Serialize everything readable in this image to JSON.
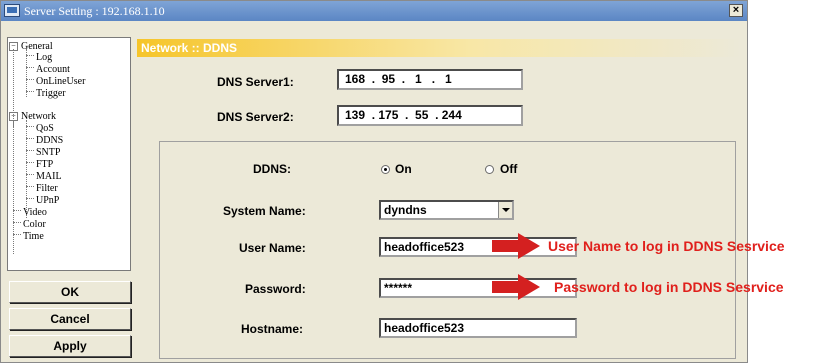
{
  "window": {
    "title": "Server Setting : 192.168.1.10",
    "close_label": "×"
  },
  "tree": {
    "general": {
      "label": "General",
      "toggle": "−",
      "children": [
        "Log",
        "Account",
        "OnLineUser",
        "Trigger"
      ]
    },
    "network": {
      "label": "Network",
      "toggle": "−",
      "children": [
        "QoS",
        "DDNS",
        "SNTP",
        "FTP",
        "MAIL",
        "Filter",
        "UPnP"
      ]
    },
    "others": [
      "Video",
      "Color",
      "Time"
    ]
  },
  "buttons": {
    "ok": "OK",
    "cancel": "Cancel",
    "apply": "Apply"
  },
  "panel": {
    "header": "Network :: DDNS",
    "dns1": {
      "label": "DNS Server1:",
      "value": "168  .  95  .   1   .   1"
    },
    "dns2": {
      "label": "DNS Server2:",
      "value": "139  . 175  .  55  . 244"
    },
    "ddns": {
      "label": "DDNS:",
      "on": "On",
      "off": "Off",
      "selected": "On"
    },
    "system_name": {
      "label": "System Name:",
      "value": "dyndns"
    },
    "user_name": {
      "label": "User Name:",
      "value": "headoffice523"
    },
    "password": {
      "label": "Password:",
      "value": "******"
    },
    "hostname": {
      "label": "Hostname:",
      "value": "headoffice523"
    }
  },
  "annotations": {
    "user": "User Name to log in DDNS Sesrvice",
    "password": "Password to log in DDNS Sesrvice",
    "color": "#e0201c"
  },
  "colors": {
    "header_gold": "#f6c52a",
    "arrow_red": "#d42020",
    "window_bg": "#ece9d8"
  }
}
